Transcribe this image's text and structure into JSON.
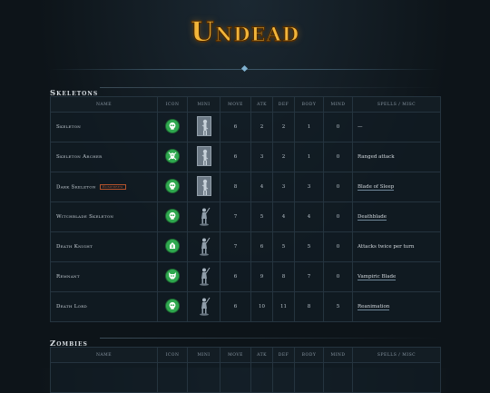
{
  "page": {
    "title": "Undead"
  },
  "sections": [
    {
      "label": "Skeletons",
      "headers": [
        "Name",
        "Icon",
        "Mini",
        "Move",
        "Atk",
        "Def",
        "Body",
        "Mind",
        "Spells / Misc"
      ],
      "rows": [
        {
          "name": "Skeleton",
          "badge": "",
          "icon": "skull-icon",
          "mini": "card",
          "move": "6",
          "atk": "2",
          "def": "2",
          "body": "1",
          "mind": "0",
          "spell": "—",
          "spell_link": false,
          "atk_red": false,
          "def_red": false,
          "body_red": false
        },
        {
          "name": "Skeleton Archer",
          "badge": "",
          "icon": "crossed-bones-icon",
          "mini": "card",
          "move": "6",
          "atk": "3",
          "def": "2",
          "body": "1",
          "mind": "0",
          "spell": "Ranged attack",
          "spell_link": false,
          "atk_red": false,
          "def_red": false,
          "body_red": false
        },
        {
          "name": "Dark Skeleton",
          "badge": "Homebrew",
          "icon": "skull-icon",
          "mini": "card",
          "move": "8",
          "atk": "4",
          "def": "3",
          "body": "3",
          "mind": "0",
          "spell": "Blade of Sleep",
          "spell_link": true,
          "atk_red": false,
          "def_red": false,
          "body_red": false
        },
        {
          "name": "Witchblade Skeleton",
          "badge": "",
          "icon": "skull-icon",
          "mini": "figure",
          "move": "7",
          "atk": "5",
          "def": "4",
          "body": "4",
          "mind": "0",
          "spell": "Deathblade",
          "spell_link": true,
          "atk_red": false,
          "def_red": false,
          "body_red": false
        },
        {
          "name": "Death Knight",
          "badge": "",
          "icon": "helm-icon",
          "mini": "figure",
          "move": "7",
          "atk": "6",
          "def": "5",
          "body": "5",
          "mind": "0",
          "spell": "Attacks twice per turn",
          "spell_link": false,
          "atk_red": true,
          "def_red": true,
          "body_red": false
        },
        {
          "name": "Remnant",
          "badge": "",
          "icon": "demon-skull-icon",
          "mini": "figure",
          "move": "6",
          "atk": "9",
          "def": "8",
          "body": "7",
          "mind": "0",
          "spell": "Vampiric Blade",
          "spell_link": true,
          "atk_red": true,
          "def_red": true,
          "body_red": false
        },
        {
          "name": "Death Lord",
          "badge": "",
          "icon": "skull-icon",
          "mini": "figure",
          "move": "6",
          "atk": "10",
          "def": "11",
          "body": "8",
          "mind": "5",
          "spell": "Reanimation",
          "spell_link": true,
          "atk_red": true,
          "def_red": true,
          "body_red": true
        }
      ]
    },
    {
      "label": "Zombies",
      "headers": [
        "Name",
        "Icon",
        "Mini",
        "Move",
        "Atk",
        "Def",
        "Body",
        "Mind",
        "Spells / Misc"
      ],
      "rows": []
    }
  ],
  "colors": {
    "accent": "#f2b53a",
    "icon_green": "#2fa84f",
    "stat_red": "#d5542e",
    "background": "#0d1419"
  }
}
